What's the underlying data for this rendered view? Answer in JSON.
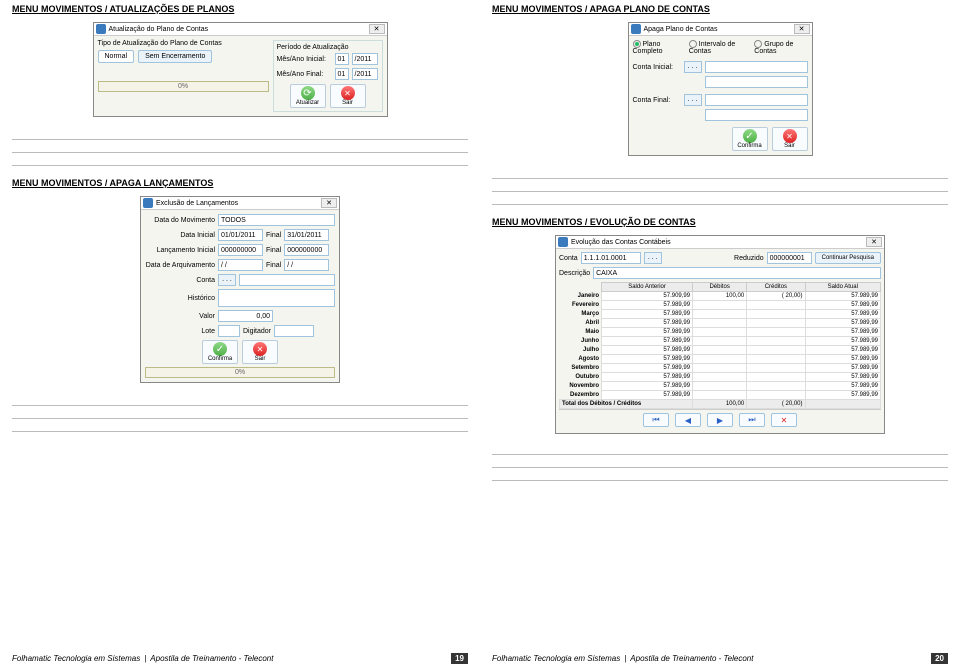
{
  "left": {
    "sectionA_title": "MENU MOVIMENTOS / ATUALIZAÇÕES DE PLANOS",
    "dialogA": {
      "title": "Atualização do Plano de Contas",
      "tipoLabel": "Tipo de Atualização do Plano de Contas",
      "tab1": "Normal",
      "tab2": "Sem Encerramento",
      "periodoTitle": "Período de Atualização",
      "mesIniLabel": "Mês/Ano Inicial:",
      "mesIniM": "01",
      "mesIniY": "/2011",
      "mesFimLabel": "Mês/Ano Final:",
      "mesFimM": "01",
      "mesFimY": "/2011",
      "progress": "0%",
      "btnAtualizar": "Atualizar",
      "btnSair": "Sair"
    },
    "sectionB_title": "MENU MOVIMENTOS / APAGA LANÇAMENTOS",
    "dialogB": {
      "title": "Exclusão de Lançamentos",
      "dataMovLabel": "Data do Movimento",
      "dataMovVal": "TODOS",
      "dataInicialLabel": "Data Inicial",
      "dataInicialVal": "01/01/2011",
      "finalLabel": "Final",
      "dataFinalVal": "31/01/2011",
      "lancIniLabel": "Lançamento Inicial",
      "lancIniVal": "000000000",
      "finalLabel2": "Final",
      "lancFimVal": "000000000",
      "dataArqLabel": "Data de Arquivamento",
      "dataArqVal": "/   /",
      "finalLabel3": "Final",
      "dataArqFimVal": "/   /",
      "contaLabel": "Conta",
      "contaBtn": ". . .",
      "historicoLabel": "Histórico",
      "valorLabel": "Valor",
      "valorVal": "0,00",
      "loteLabel": "Lote",
      "digitadorLabel": "Digitador",
      "btnConfirma": "Confirma",
      "btnSair": "Sair",
      "progress": "0%"
    },
    "footer_company": "Folhamatic Tecnologia em Sistemas",
    "footer_doc": "Apostila de Treinamento - Telecont",
    "footer_page": "19"
  },
  "right": {
    "sectionA_title": "MENU MOVIMENTOS / APAGA PLANO DE CONTAS",
    "dialogA": {
      "title": "Apaga Plano de Contas",
      "r1": "Plano Completo",
      "r2": "Intervalo de Contas",
      "r3": "Grupo de Contas",
      "contaIniLabel": "Conta Inicial:",
      "dots": ". . .",
      "contaFimLabel": "Conta Final:",
      "btnConfirma": "Confirma",
      "btnSair": "Sair"
    },
    "sectionB_title": "MENU MOVIMENTOS / EVOLUÇÃO DE CONTAS",
    "dialogB": {
      "title": "Evolução das Contas Contábeis",
      "contaLabel": "Conta",
      "contaVal": "1.1.1.01.0001",
      "dots": ". . .",
      "reduzidoLabel": "Reduzido",
      "reduzidoVal": "000000001",
      "contPesq": "Continuar Pesquisa",
      "descLabel": "Descrição",
      "descVal": "CAIXA",
      "h_saldoAnt": "Saldo Anterior",
      "h_deb": "Débitos",
      "h_cred": "Créditos",
      "h_saldoAtual": "Saldo Atual",
      "months": [
        "Janeiro",
        "Fevereiro",
        "Março",
        "Abril",
        "Maio",
        "Junho",
        "Julho",
        "Agosto",
        "Setembro",
        "Outubro",
        "Novembro",
        "Dezembro"
      ],
      "row_jan": {
        "sa": "57.909,99",
        "d": "100,00",
        "c": "(          20,00)",
        "sat": "57.989,99"
      },
      "val_default_sa": "57.989,99",
      "val_default_sat": "57.989,99",
      "total_label": "Total dos Débitos / Créditos",
      "total_d": "100,00",
      "total_c": "(          20,00)"
    },
    "footer_company": "Folhamatic Tecnologia em Sistemas",
    "footer_doc": "Apostila de Treinamento - Telecont",
    "footer_page": "20"
  }
}
